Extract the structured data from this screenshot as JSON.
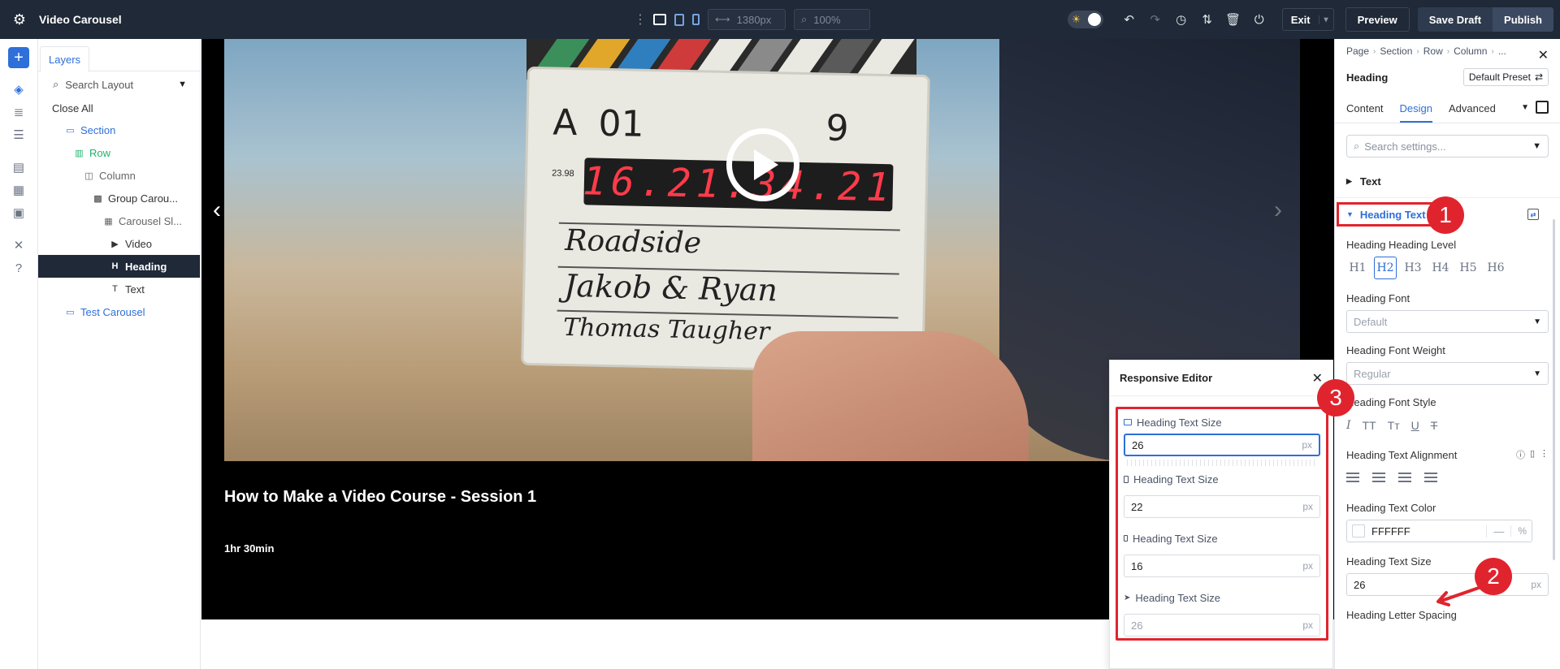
{
  "topbar": {
    "title": "Video Carousel",
    "width_value": "1380px",
    "zoom_value": "100%",
    "exit_label": "Exit",
    "preview_label": "Preview",
    "save_draft_label": "Save Draft",
    "publish_label": "Publish"
  },
  "layers": {
    "tab_label": "Layers",
    "search_placeholder": "Search Layout",
    "close_all": "Close All",
    "tree": [
      {
        "label": "Section"
      },
      {
        "label": "Row"
      },
      {
        "label": "Column"
      },
      {
        "label": "Group Carou..."
      },
      {
        "label": "Carousel Sl..."
      },
      {
        "label": "Video"
      },
      {
        "label": "Heading"
      },
      {
        "label": "Text"
      },
      {
        "label": "Test Carousel"
      }
    ]
  },
  "canvas": {
    "slide_title": "How to Make a Video Course - Session 1",
    "slide_duration": "1hr 30min",
    "slate": {
      "timecode": "16.21.34.21",
      "roll": "A",
      "scene": "01",
      "take": "9",
      "fps": "23.98",
      "line1": "Roadside",
      "line2": "Jakob & Ryan",
      "line3": "Thomas Taugher"
    }
  },
  "responsive_editor": {
    "title": "Responsive Editor",
    "fields": [
      {
        "label": "Heading Text Size",
        "value": "26",
        "unit": "px"
      },
      {
        "label": "Heading Text Size",
        "value": "22",
        "unit": "px"
      },
      {
        "label": "Heading Text Size",
        "value": "16",
        "unit": "px"
      },
      {
        "label": "Heading Text Size",
        "value": "26",
        "unit": "px"
      }
    ]
  },
  "settings": {
    "breadcrumb": [
      "Page",
      "Section",
      "Row",
      "Column",
      "..."
    ],
    "module_name": "Heading",
    "preset_label": "Default Preset",
    "tabs": [
      "Content",
      "Design",
      "Advanced"
    ],
    "search_placeholder": "Search settings...",
    "group_text": "Text",
    "group_heading_text": "Heading Text",
    "heading_level_label": "Heading Heading Level",
    "heading_levels": [
      "H1",
      "H2",
      "H3",
      "H4",
      "H5",
      "H6"
    ],
    "heading_font_label": "Heading Font",
    "heading_font_value": "Default",
    "heading_font_weight_label": "Heading Font Weight",
    "heading_font_weight_value": "Regular",
    "heading_font_style_label": "Heading Font Style",
    "heading_text_alignment_label": "Heading Text Alignment",
    "heading_text_color_label": "Heading Text Color",
    "heading_text_color_value": "FFFFFF",
    "heading_text_size_label": "Heading Text Size",
    "heading_text_size_value": "26",
    "heading_text_size_unit": "px",
    "heading_letter_spacing_label": "Heading Letter Spacing"
  },
  "annotations": [
    "1",
    "2",
    "3"
  ],
  "colors": {
    "accent": "#2e6fd9",
    "annotation_red": "#e0242e",
    "topbar_bg": "#1f2937"
  }
}
